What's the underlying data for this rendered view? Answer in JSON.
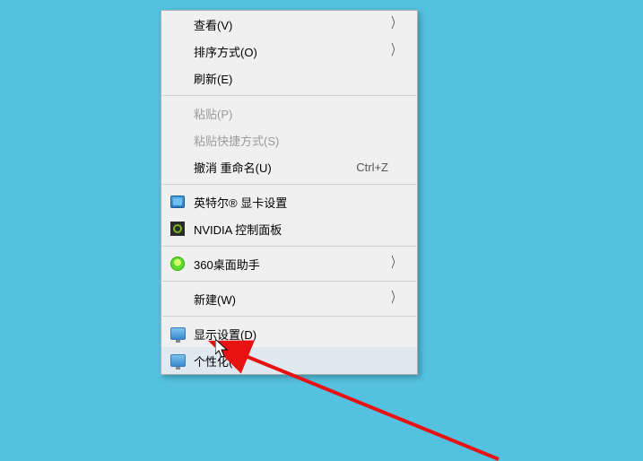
{
  "menu": {
    "view": {
      "label": "查看(V)",
      "has_submenu": true
    },
    "sort": {
      "label": "排序方式(O)",
      "has_submenu": true
    },
    "refresh": {
      "label": "刷新(E)"
    },
    "paste": {
      "label": "粘贴(P)"
    },
    "paste_shortcut": {
      "label": "粘贴快捷方式(S)"
    },
    "undo_rename": {
      "label": "撤消 重命名(U)",
      "shortcut": "Ctrl+Z"
    },
    "intel": {
      "label": "英特尔® 显卡设置"
    },
    "nvidia": {
      "label": "NVIDIA 控制面板"
    },
    "desktop_assistant": {
      "label": "360桌面助手",
      "has_submenu": true
    },
    "new": {
      "label": "新建(W)",
      "has_submenu": true
    },
    "display_settings": {
      "label": "显示设置(D)"
    },
    "personalize": {
      "label": "个性化(R)"
    }
  }
}
